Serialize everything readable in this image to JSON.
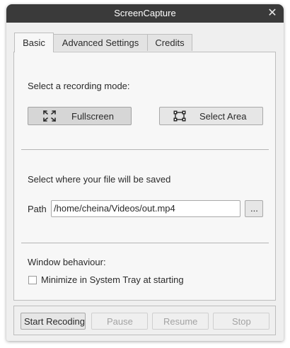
{
  "window": {
    "title": "ScreenCapture",
    "close_glyph": "✕",
    "close_icon": "close-icon"
  },
  "tabs": [
    {
      "label": "Basic",
      "active": true
    },
    {
      "label": "Advanced Settings",
      "active": false
    },
    {
      "label": "Credits",
      "active": false
    }
  ],
  "recording_mode": {
    "heading": "Select a recording mode:",
    "fullscreen_label": "Fullscreen",
    "fullscreen_icon": "fullscreen-icon",
    "select_area_label": "Select Area",
    "select_area_icon": "select-area-icon"
  },
  "save_location": {
    "heading": "Select where your file will be saved",
    "path_label": "Path",
    "path_value": "/home/cheina/Videos/out.mp4",
    "browse_label": "..."
  },
  "window_behaviour": {
    "heading": "Window behaviour:",
    "minimize_label": "Minimize in System Tray at starting",
    "minimize_checked": false
  },
  "controls": {
    "start_label": "Start Recoding",
    "pause_label": "Pause",
    "resume_label": "Resume",
    "stop_label": "Stop"
  },
  "colors": {
    "titlebar": "#3a3a3a",
    "window_bg": "#efefef",
    "panel_bg": "#f7f7f7",
    "disabled_text": "#a3a3a3"
  }
}
